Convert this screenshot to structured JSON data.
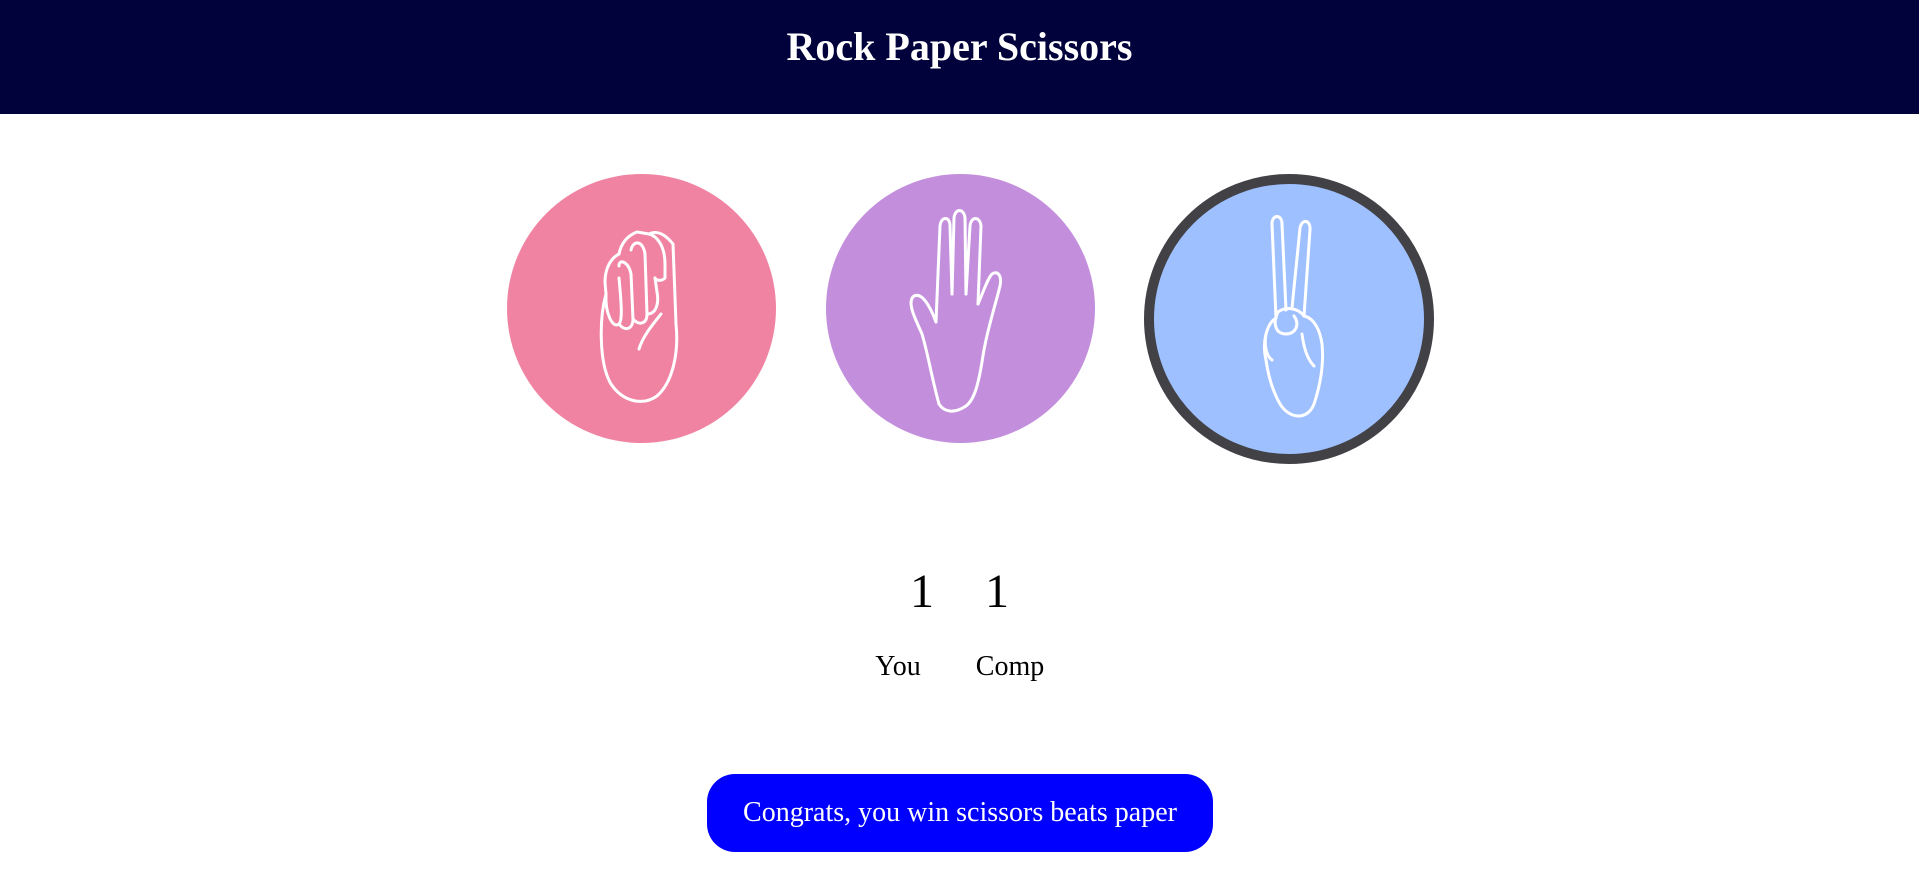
{
  "header": {
    "title": "Rock Paper Scissors"
  },
  "choices": [
    {
      "name": "rock",
      "icon": "fist-icon",
      "color": "#f083a2",
      "selected": false
    },
    {
      "name": "paper",
      "icon": "open-hand-icon",
      "color": "#c38fdd",
      "selected": false
    },
    {
      "name": "scissors",
      "icon": "peace-hand-icon",
      "color": "#9fc0ff",
      "selected": true,
      "border_color": "#414146"
    }
  ],
  "score": {
    "you": "1",
    "comp": "1",
    "you_label": "You",
    "comp_label": "Comp"
  },
  "result": {
    "message": "Congrats, you win scissors beats paper",
    "color": "#0000ff"
  }
}
